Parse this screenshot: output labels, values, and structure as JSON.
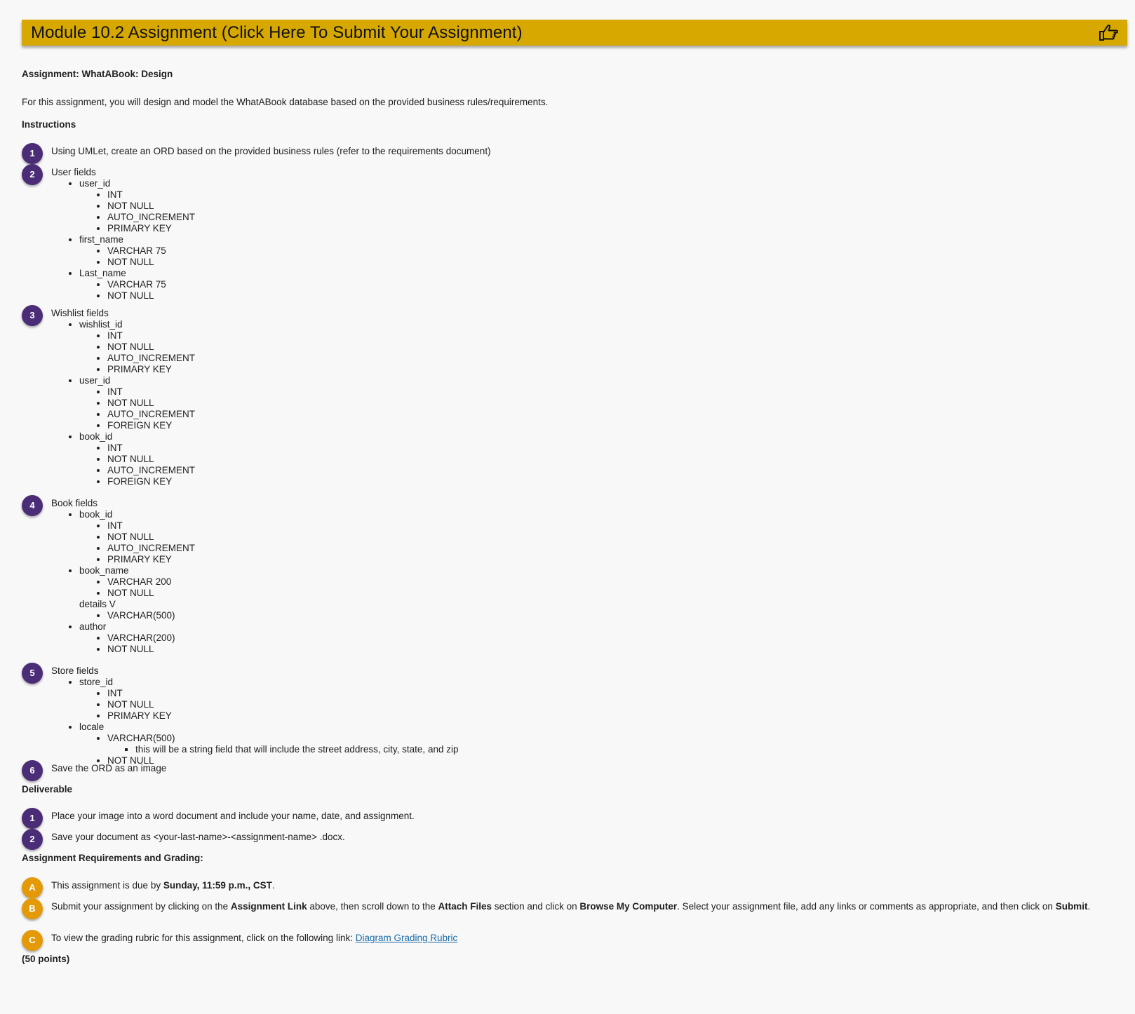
{
  "banner": {
    "title": "Module 10.2 Assignment (Click Here To Submit Your Assignment)",
    "icon": "pointing-hand-icon",
    "color": "#d6a800"
  },
  "assignment_title": "Assignment: WhatABook: Design",
  "intro": "For this assignment, you will design and model the WhatABook database based on the provided business rules/requirements.",
  "instructions_heading": "Instructions",
  "steps": {
    "s1": {
      "num": "1",
      "text": "Using UMLet, create an ORD based on the provided business rules (refer to the requirements document)"
    },
    "s2": {
      "num": "2",
      "text": "User fields",
      "user_id": "user_id",
      "first_name": "first_name",
      "last_name": "Last_name"
    },
    "s3": {
      "num": "3",
      "text": "Wishlist fields",
      "wishlist_id": "wishlist_id",
      "user_id": "user_id",
      "book_id": "book_id"
    },
    "s4": {
      "num": "4",
      "text": "Book fields",
      "book_id": "book_id",
      "book_name": "book_name",
      "details": "details V",
      "author": "author"
    },
    "s5": {
      "num": "5",
      "text": "Store fields",
      "store_id": "store_id",
      "locale": "locale",
      "locale_note": "this will be a string field that will include the street address, city, state, and zip"
    },
    "s6": {
      "num": "6",
      "text": "Save the ORD as an image"
    }
  },
  "types": {
    "int": "INT",
    "not_null": "NOT NULL",
    "auto_increment": "AUTO_INCREMENT",
    "primary_key": "PRIMARY KEY",
    "foreign_key": "FOREIGN KEY",
    "varchar_75": "VARCHAR 75",
    "varchar_200": "VARCHAR 200",
    "varchar_500_paren": "VARCHAR(500)",
    "varchar_200_paren": "VARCHAR(200)"
  },
  "deliverable_heading": "Deliverable",
  "deliverables": {
    "d1": {
      "num": "1",
      "text": "Place your image into a word document and include your name, date, and assignment."
    },
    "d2": {
      "num": "2",
      "text": "Save your document as <your-last-name>-<assignment-name> .docx."
    }
  },
  "grading_heading": "Assignment Requirements and Grading:",
  "grading": {
    "a": {
      "letter": "A",
      "pre": "This assignment is due by ",
      "bold": "Sunday, 11:59 p.m., CST",
      "post": "."
    },
    "b": {
      "letter": "B",
      "t1": "Submit your assignment by clicking on the ",
      "b1": "Assignment Link",
      "t2": " above, then scroll down to the ",
      "b2": "Attach Files",
      "t3": " section and click on ",
      "b3": "Browse My Computer",
      "t4": ". Select your assignment file, add any links or comments as appropriate, and then click on ",
      "b4": "Submit",
      "t5": "."
    },
    "c": {
      "letter": "C",
      "pre": "To view the grading rubric for this assignment, click on the following link: ",
      "link": "Diagram Grading Rubric"
    }
  },
  "points": "(50 points)",
  "colors": {
    "purple_badge": "#4b2c77",
    "orange_badge": "#e49a06",
    "link": "#1a6ba8"
  }
}
